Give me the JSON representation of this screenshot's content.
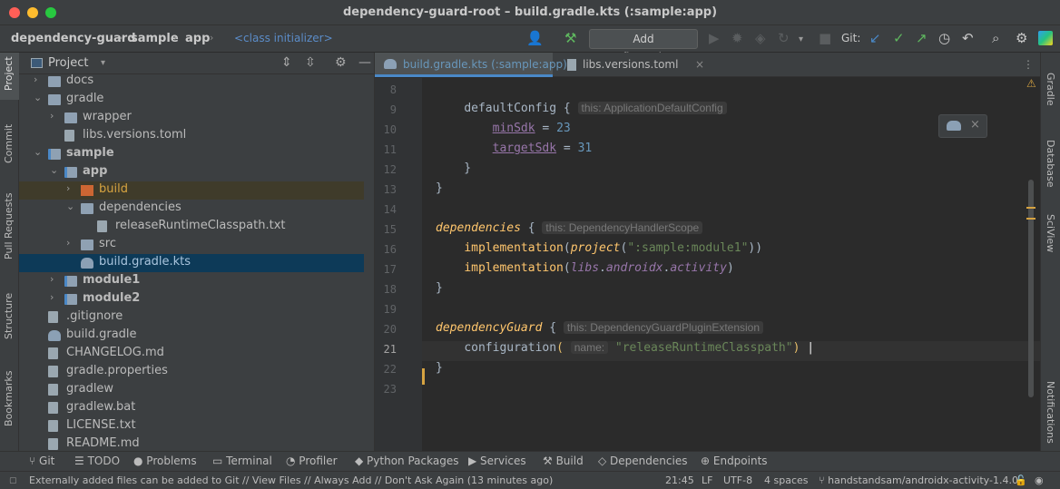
{
  "window": {
    "title": "dependency-guard-root – build.gradle.kts (:sample:app)"
  },
  "breadcrumbs": [
    "dependency-guard",
    "sample",
    "app"
  ],
  "class_initializer": "<class initializer>",
  "toolbar": {
    "add_configuration": "Add Configuration...",
    "git_label": "Git:"
  },
  "left_strip": [
    "Project",
    "Commit",
    "Pull Requests",
    "Structure",
    "Bookmarks"
  ],
  "right_strip": [
    "Gradle",
    "Database",
    "SciView",
    "Notifications"
  ],
  "project_panel": {
    "title": "Project",
    "tree": [
      {
        "label": "docs",
        "kind": "folder",
        "depth": 1,
        "expanded": false
      },
      {
        "label": "gradle",
        "kind": "folder",
        "depth": 1,
        "expanded": true
      },
      {
        "label": "wrapper",
        "kind": "folder",
        "depth": 2,
        "expanded": false
      },
      {
        "label": "libs.versions.toml",
        "kind": "file",
        "depth": 2
      },
      {
        "label": "sample",
        "kind": "module",
        "depth": 1,
        "expanded": true
      },
      {
        "label": "app",
        "kind": "module",
        "depth": 2,
        "expanded": true
      },
      {
        "label": "build",
        "kind": "build",
        "depth": 3,
        "expanded": false
      },
      {
        "label": "dependencies",
        "kind": "folder",
        "depth": 3,
        "expanded": true
      },
      {
        "label": "releaseRuntimeClasspath.txt",
        "kind": "file",
        "depth": 4
      },
      {
        "label": "src",
        "kind": "folder",
        "depth": 3,
        "expanded": false
      },
      {
        "label": "build.gradle.kts",
        "kind": "gradle",
        "depth": 3,
        "selected": true
      },
      {
        "label": "module1",
        "kind": "module",
        "depth": 2,
        "expanded": false
      },
      {
        "label": "module2",
        "kind": "module",
        "depth": 2,
        "expanded": false
      },
      {
        "label": ".gitignore",
        "kind": "file",
        "depth": 1
      },
      {
        "label": "build.gradle",
        "kind": "gradle",
        "depth": 1
      },
      {
        "label": "CHANGELOG.md",
        "kind": "file",
        "depth": 1
      },
      {
        "label": "gradle.properties",
        "kind": "file",
        "depth": 1
      },
      {
        "label": "gradlew",
        "kind": "file",
        "depth": 1
      },
      {
        "label": "gradlew.bat",
        "kind": "file",
        "depth": 1
      },
      {
        "label": "LICENSE.txt",
        "kind": "file",
        "depth": 1
      },
      {
        "label": "README.md",
        "kind": "file",
        "depth": 1
      }
    ]
  },
  "editor": {
    "tabs": [
      {
        "label": "build.gradle.kts (:sample:app)",
        "active": true
      },
      {
        "label": "libs.versions.toml",
        "active": false
      }
    ],
    "line_numbers": [
      "8",
      "9",
      "10",
      "11",
      "12",
      "13",
      "14",
      "15",
      "16",
      "17",
      "18",
      "19",
      "20",
      "21",
      "22",
      "23"
    ],
    "hints": {
      "line9": "this: ApplicationDefaultConfig",
      "line15": "this: DependencyHandlerScope",
      "line20": "this: DependencyGuardPluginExtension",
      "line21": "name:"
    },
    "code": {
      "defaultConfig": "defaultConfig",
      "minSdk": "minSdk",
      "minSdk_val": "23",
      "targetSdk": "targetSdk",
      "targetSdk_val": "31",
      "dependencies": "dependencies",
      "implementation": "implementation",
      "project": "project",
      "project_arg": "\":sample:module1\"",
      "libs": "libs",
      "androidx": "androidx",
      "activity": "activity",
      "dependencyGuard": "dependencyGuard",
      "configuration": "configuration",
      "config_arg": "\"releaseRuntimeClasspath\""
    }
  },
  "tool_windows": [
    "Git",
    "TODO",
    "Problems",
    "Terminal",
    "Profiler",
    "Python Packages",
    "Services",
    "Build",
    "Dependencies",
    "Endpoints"
  ],
  "status_bar": {
    "message": "Externally added files can be added to Git // View Files // Always Add // Don't Ask Again (13 minutes ago)",
    "position": "21:45",
    "line_sep": "LF",
    "encoding": "UTF-8",
    "indent": "4 spaces",
    "branch": "handstandsam/androidx-activity-1.4.0"
  },
  "colors": {
    "accent": "#4a88c7",
    "keyword": "#cc7832",
    "string": "#6a8759",
    "number": "#6897bb"
  }
}
